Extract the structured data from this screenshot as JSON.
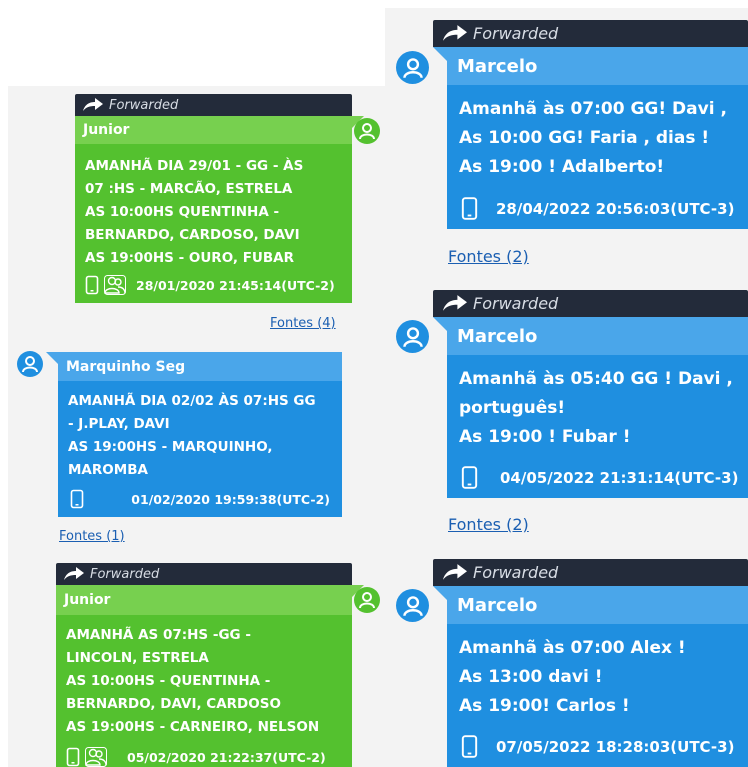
{
  "colors": {
    "green_bubble": "#54c12f",
    "blue_bubble": "#1f8fe0",
    "forward_bar": "#232b3a",
    "link": "#1b5fb2"
  },
  "left": {
    "msg1": {
      "forwarded_label": "Forwarded",
      "sender": "Junior",
      "lines": [
        "AMANHÃ DIA 29/01 - GG - ÀS",
        "07 :HS - MARCÃO, ESTRELA",
        "AS 10:00HS QUENTINHA -",
        "BERNARDO, CARDOSO, DAVI",
        "AS 19:00HS - OURO, FUBAR"
      ],
      "timestamp": "28/01/2020 21:45:14(UTC-2)",
      "icons": [
        "phone-icon",
        "group-icon"
      ],
      "avatar_icon": "user-avatar-icon",
      "sources_link": "Fontes (4)"
    },
    "msg2": {
      "sender": "Marquinho Seg",
      "lines": [
        "AMANHÃ DIA 02/02 ÀS 07:HS GG",
        "- J.PLAY, DAVI",
        "AS 19:00HS - MARQUINHO,",
        "MAROMBA"
      ],
      "timestamp": "01/02/2020 19:59:38(UTC-2)",
      "icons": [
        "phone-icon"
      ],
      "avatar_icon": "user-avatar-icon",
      "sources_link": "Fontes (1)"
    },
    "msg3": {
      "forwarded_label": "Forwarded",
      "sender": "Junior",
      "lines": [
        "AMANHÃ AS 07:HS -GG -",
        "LINCOLN, ESTRELA",
        "AS 10:00HS - QUENTINHA -",
        "BERNARDO, DAVI, CARDOSO",
        "AS 19:00HS - CARNEIRO, NELSON"
      ],
      "timestamp": "05/02/2020 21:22:37(UTC-2)",
      "icons": [
        "phone-icon",
        "group-icon"
      ],
      "avatar_icon": "user-avatar-icon"
    }
  },
  "right": {
    "msg1": {
      "forwarded_label": "Forwarded",
      "sender": "Marcelo",
      "lines": [
        "Amanhã às 07:00 GG! Davi ,",
        "As 10:00 GG! Faria , dias !",
        "As 19:00 ! Adalberto!"
      ],
      "timestamp": "28/04/2022 20:56:03(UTC-3)",
      "icons": [
        "phone-icon"
      ],
      "avatar_icon": "user-avatar-icon",
      "sources_link": "Fontes (2)"
    },
    "msg2": {
      "forwarded_label": "Forwarded",
      "sender": "Marcelo",
      "lines": [
        "Amanhã às 05:40 GG ! Davi ,",
        "português!",
        "As 19:00 ! Fubar !"
      ],
      "timestamp": "04/05/2022 21:31:14(UTC-3)",
      "icons": [
        "phone-icon"
      ],
      "avatar_icon": "user-avatar-icon",
      "sources_link": "Fontes (2)"
    },
    "msg3": {
      "forwarded_label": "Forwarded",
      "sender": "Marcelo",
      "lines": [
        "Amanhã às 07:00 Alex !",
        "As 13:00 davi !",
        "As 19:00! Carlos !"
      ],
      "timestamp": "07/05/2022 18:28:03(UTC-3)",
      "icons": [
        "phone-icon"
      ],
      "avatar_icon": "user-avatar-icon"
    }
  }
}
